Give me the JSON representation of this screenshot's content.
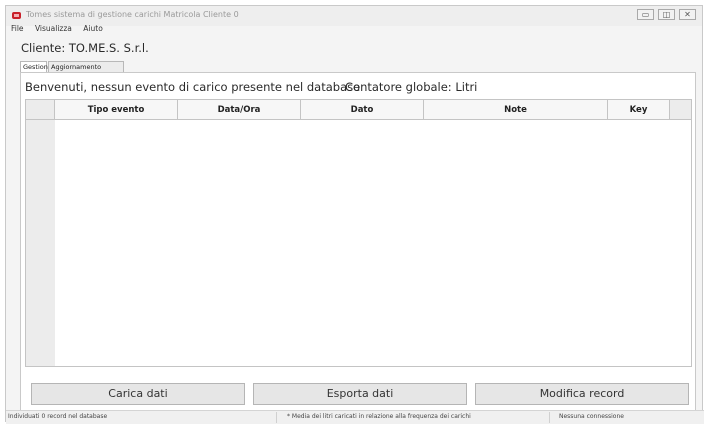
{
  "window": {
    "title": "Tomes sistema di gestione carichi Matricola Cliente 0",
    "controls": {
      "minimize": "▭",
      "restore": "◫",
      "close": "✕"
    }
  },
  "menu": [
    "File",
    "Visualizza",
    "Aiuto"
  ],
  "client_label": "Cliente: TO.ME.S. S.r.l.",
  "tabs": [
    {
      "label": "Gestione",
      "active": true
    },
    {
      "label": "Aggiornamento",
      "active": false
    }
  ],
  "main": {
    "welcome": "Benvenuti, nessun evento di carico presente nel database",
    "global_counter": "Contatore globale: Litri",
    "table": {
      "columns": [
        "Tipo evento",
        "Data/Ora",
        "Dato",
        "Note",
        "Key"
      ],
      "rows": []
    },
    "buttons": {
      "load": "Carica dati",
      "export": "Esporta dati",
      "edit": "Modifica record"
    }
  },
  "status": {
    "records": "Individuati 0 record nel database",
    "note": "* Media dei litri caricati in relazione alla frequenza dei carichi",
    "connection": "Nessuna connessione"
  },
  "colors": {
    "app_icon": "#c9202a",
    "window_bg": "#f4f4f4",
    "grid_bg": "#ececec"
  }
}
